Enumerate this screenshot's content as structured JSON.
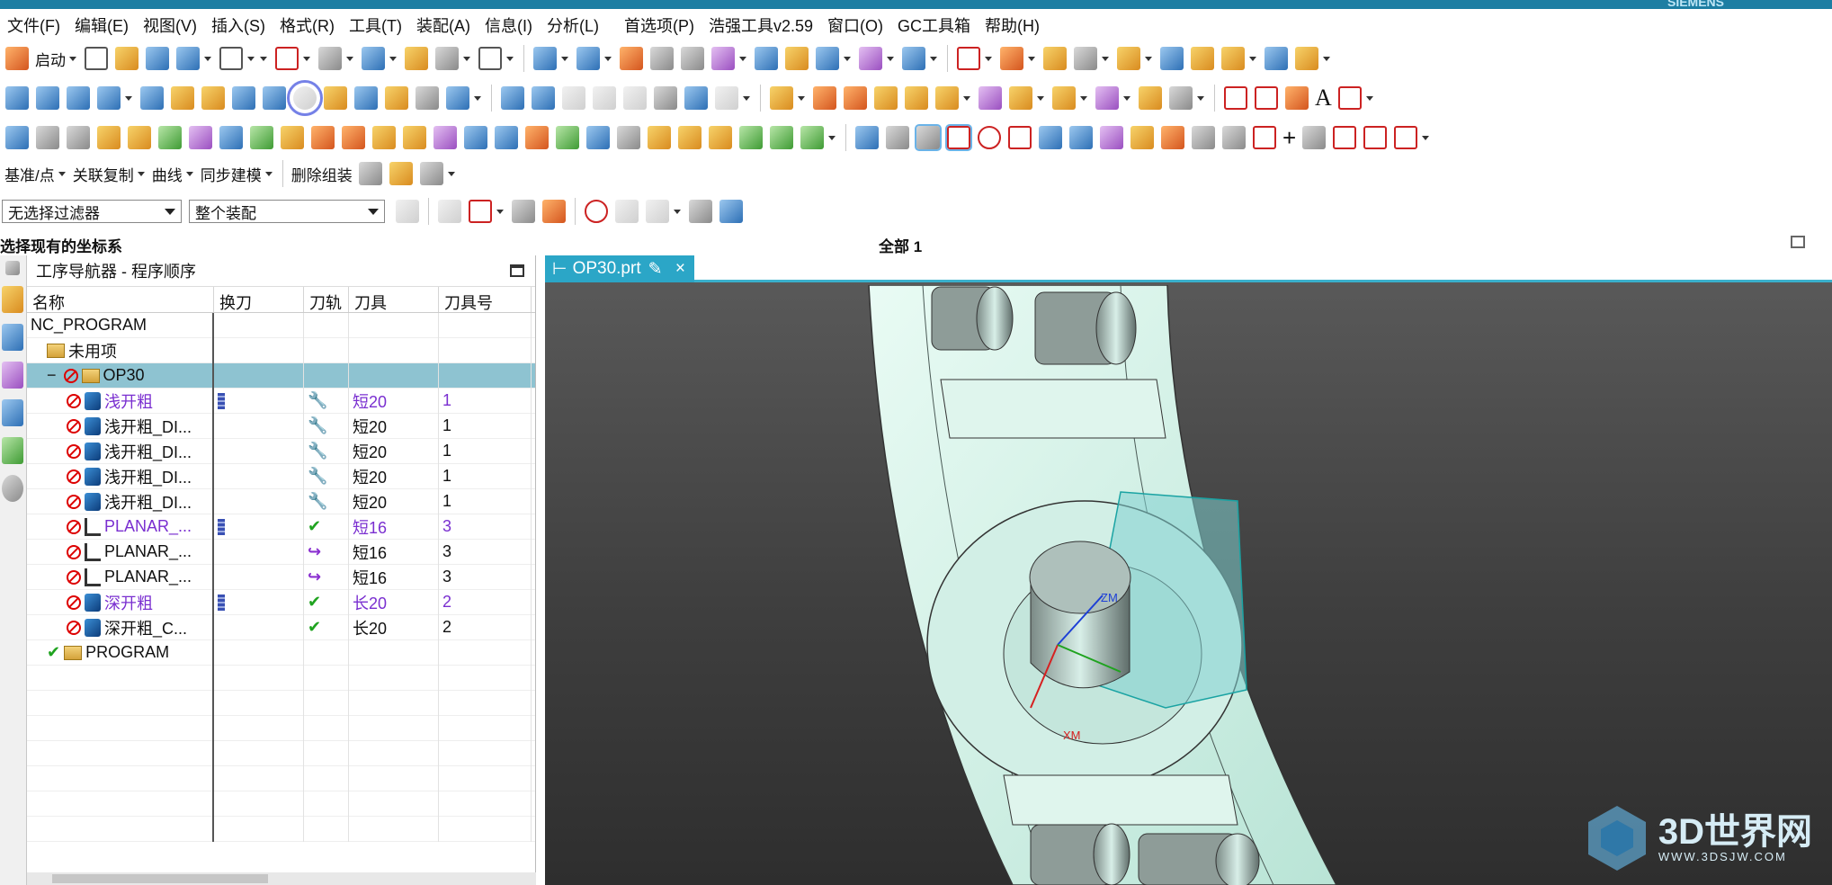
{
  "title_brand": "SIEMENS",
  "menu": [
    "文件(F)",
    "编辑(E)",
    "视图(V)",
    "插入(S)",
    "格式(R)",
    "工具(T)",
    "装配(A)",
    "信息(I)",
    "分析(L)",
    "首选项(P)",
    "浩强工具v2.59",
    "窗口(O)",
    "GC工具箱",
    "帮助(H)"
  ],
  "toolbar1": {
    "start_label": "启动"
  },
  "toolbar4": {
    "datum_label": "基准/点",
    "assoc_copy_label": "关联复制",
    "curve_label": "曲线",
    "sync_label": "同步建模",
    "delete_group_label": "删除组装"
  },
  "filters": {
    "selection_filter": "无选择过滤器",
    "assembly_scope": "整个装配"
  },
  "status": {
    "prompt": "选择现有的坐标系",
    "center": "全部 1"
  },
  "navigator": {
    "title": "工序导航器 - 程序顺序",
    "columns": [
      "名称",
      "换刀",
      "刀轨",
      "刀具",
      "刀具号"
    ],
    "rows": [
      {
        "name": "NC_PROGRAM",
        "indent": 0,
        "kind": "root",
        "tool": "",
        "num": "",
        "path": "",
        "change": false,
        "purple": false,
        "sel": false
      },
      {
        "name": "未用项",
        "indent": 1,
        "kind": "folder",
        "tool": "",
        "num": "",
        "path": "",
        "change": false,
        "purple": false,
        "sel": false
      },
      {
        "name": "OP30",
        "indent": 1,
        "kind": "group",
        "tool": "",
        "num": "",
        "path": "",
        "change": false,
        "purple": false,
        "sel": true
      },
      {
        "name": "浅开粗",
        "indent": 2,
        "kind": "op",
        "tool": "短20",
        "num": "1",
        "path": "wrench",
        "change": true,
        "purple": true,
        "sel": false
      },
      {
        "name": "浅开粗_DI...",
        "indent": 2,
        "kind": "op",
        "tool": "短20",
        "num": "1",
        "path": "wrench",
        "change": false,
        "purple": false,
        "sel": false
      },
      {
        "name": "浅开粗_DI...",
        "indent": 2,
        "kind": "op",
        "tool": "短20",
        "num": "1",
        "path": "wrench",
        "change": false,
        "purple": false,
        "sel": false
      },
      {
        "name": "浅开粗_DI...",
        "indent": 2,
        "kind": "op",
        "tool": "短20",
        "num": "1",
        "path": "wrench",
        "change": false,
        "purple": false,
        "sel": false
      },
      {
        "name": "浅开粗_DI...",
        "indent": 2,
        "kind": "op",
        "tool": "短20",
        "num": "1",
        "path": "wrench",
        "change": false,
        "purple": false,
        "sel": false
      },
      {
        "name": "PLANAR_...",
        "indent": 2,
        "kind": "planar",
        "tool": "短16",
        "num": "3",
        "path": "check",
        "change": true,
        "purple": true,
        "sel": false
      },
      {
        "name": "PLANAR_...",
        "indent": 2,
        "kind": "planar",
        "tool": "短16",
        "num": "3",
        "path": "arrow",
        "change": false,
        "purple": false,
        "sel": false
      },
      {
        "name": "PLANAR_...",
        "indent": 2,
        "kind": "planar",
        "tool": "短16",
        "num": "3",
        "path": "arrow",
        "change": false,
        "purple": false,
        "sel": false
      },
      {
        "name": "深开粗",
        "indent": 2,
        "kind": "op",
        "tool": "长20",
        "num": "2",
        "path": "check",
        "change": true,
        "purple": true,
        "sel": false
      },
      {
        "name": "深开粗_C...",
        "indent": 2,
        "kind": "op",
        "tool": "长20",
        "num": "2",
        "path": "check",
        "change": false,
        "purple": false,
        "sel": false
      },
      {
        "name": "PROGRAM",
        "indent": 1,
        "kind": "program",
        "tool": "",
        "num": "",
        "path": "",
        "change": false,
        "purple": false,
        "sel": false
      }
    ]
  },
  "viewport": {
    "tab_label": "OP30.prt",
    "zm_label": "ZM",
    "xm_label": "XM"
  },
  "watermark": {
    "main": "3D世界网",
    "sub": "WWW.3DSJW.COM"
  }
}
